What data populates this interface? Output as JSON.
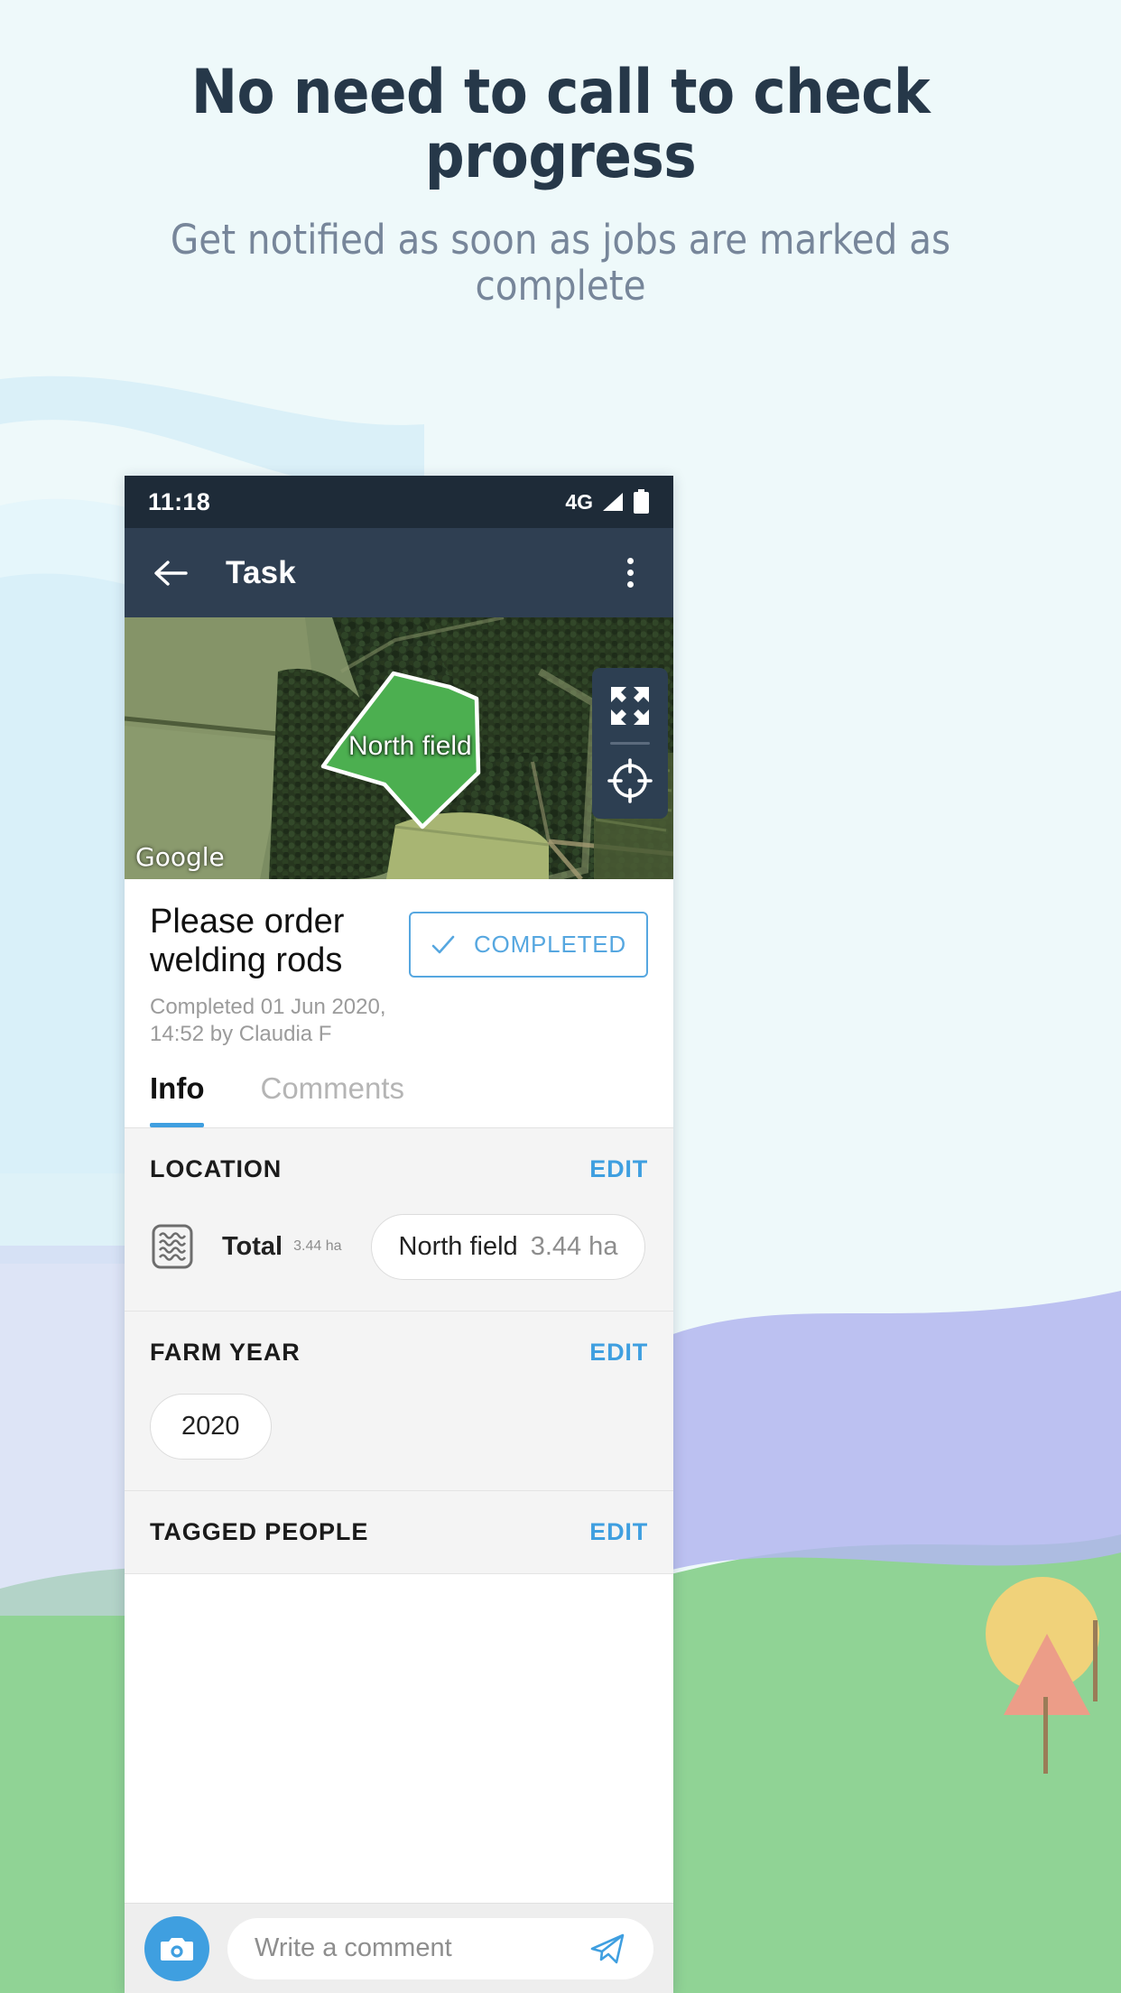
{
  "promo": {
    "title": "No need to call to check progress",
    "subtitle": "Get notified as soon as jobs are marked as complete",
    "title_color": "#263849",
    "subtitle_color": "#77869a",
    "background_color": "#eef9fa"
  },
  "phone": {
    "status_bar": {
      "time": "11:18",
      "network": "4G",
      "signal_icon": "signal-bars-icon",
      "battery_icon": "battery-full-icon",
      "background_color": "#1e2b38"
    },
    "app_bar": {
      "back_icon": "back-arrow-icon",
      "title": "Task",
      "overflow_icon": "overflow-menu-icon",
      "background_color": "#2f3f52"
    },
    "map": {
      "field_label": "North field",
      "attribution": "Google",
      "fullscreen_icon": "expand-arrows-icon",
      "locate_icon": "crosshair-location-icon",
      "field_fill_color": "#4caf50",
      "field_stroke_color": "#ffffff"
    },
    "task": {
      "title": "Please order welding rods",
      "meta": "Completed 01 Jun 2020, 14:52 by Claudia F",
      "status_button": {
        "label": "COMPLETED",
        "icon": "check-icon",
        "color": "#56a7e0"
      }
    },
    "tabs": [
      {
        "label": "Info",
        "active": true
      },
      {
        "label": "Comments",
        "active": false
      }
    ],
    "sections": [
      {
        "title": "LOCATION",
        "edit_label": "EDIT",
        "icon": "field-rows-icon",
        "total_label": "Total",
        "total_value": "3.44 ha",
        "chip_label": "North field",
        "chip_value": "3.44 ha"
      },
      {
        "title": "FARM YEAR",
        "edit_label": "EDIT",
        "pill": "2020"
      },
      {
        "title": "TAGGED PEOPLE",
        "edit_label": "EDIT"
      }
    ],
    "comment_bar": {
      "camera_icon": "camera-icon",
      "placeholder": "Write a comment",
      "send_icon": "send-paper-plane-icon",
      "accent_color": "#3f9fe0"
    }
  }
}
